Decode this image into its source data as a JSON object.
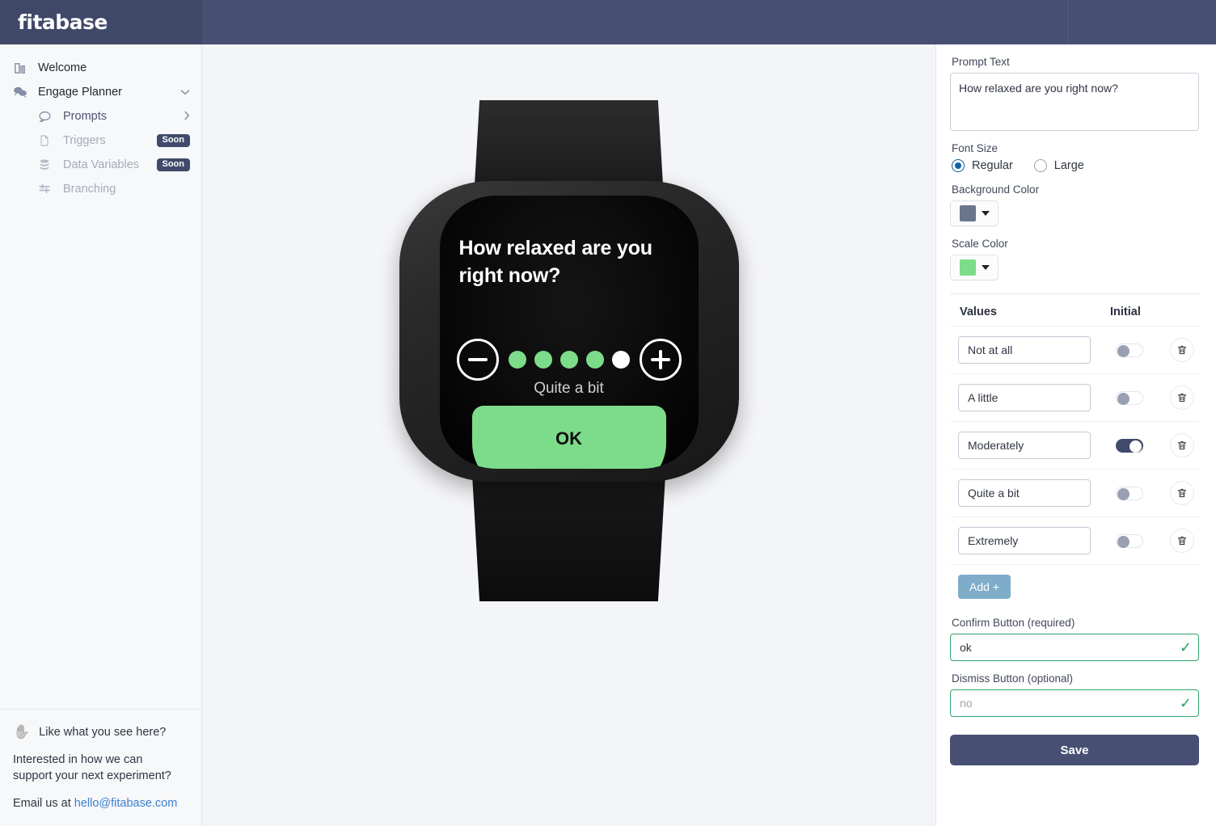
{
  "brand": {
    "name": "fitabase"
  },
  "sidebar": {
    "items": [
      {
        "label": "Welcome",
        "icon": "door-icon",
        "state": "root",
        "badge": null,
        "chevron": null
      },
      {
        "label": "Engage Planner",
        "icon": "comments-icon",
        "state": "root",
        "badge": null,
        "chevron": "chevron-down-icon"
      },
      {
        "label": "Prompts",
        "icon": "chat-bubble-icon",
        "state": "active",
        "badge": null,
        "chevron": "chevron-right-icon"
      },
      {
        "label": "Triggers",
        "icon": "file-icon",
        "state": "disabled",
        "badge": "Soon",
        "chevron": null
      },
      {
        "label": "Data Variables",
        "icon": "database-icon",
        "state": "disabled",
        "badge": "Soon",
        "chevron": null
      },
      {
        "label": "Branching",
        "icon": "branching-icon",
        "state": "disabled",
        "badge": null,
        "chevron": null
      }
    ],
    "footer": {
      "hand_icon": "hand-icon",
      "heading": "Like what you see here?",
      "body": "Interested in how we can support your next experiment?",
      "email_prefix": "Email us at ",
      "email": "hello@fitabase.com"
    }
  },
  "preview": {
    "question": "How relaxed are you right now?",
    "minus_icon": "minus-circle-icon",
    "plus_icon": "plus-circle-icon",
    "dots_total": 5,
    "dots_filled": 4,
    "selected_label": "Quite a bit",
    "confirm_label": "OK",
    "screen_bg": "#000000",
    "scale_color": "#7ddc8a",
    "dot_inactive_color": "#ffffff"
  },
  "panel": {
    "prompt_text_label": "Prompt Text",
    "prompt_text_value": "How relaxed are you right now?",
    "font_size_label": "Font Size",
    "font_size_options": [
      {
        "label": "Regular",
        "selected": true
      },
      {
        "label": "Large",
        "selected": false
      }
    ],
    "background_color_label": "Background Color",
    "background_color_value": "#6a748a",
    "scale_color_label": "Scale Color",
    "scale_color_value": "#7ddc8a",
    "table": {
      "col_values": "Values",
      "col_initial": "Initial",
      "rows": [
        {
          "value": "Not at all",
          "initial": false,
          "delete_icon": "trash-icon"
        },
        {
          "value": "A little",
          "initial": false,
          "delete_icon": "trash-icon"
        },
        {
          "value": "Moderately",
          "initial": true,
          "delete_icon": "trash-icon"
        },
        {
          "value": "Quite a bit",
          "initial": false,
          "delete_icon": "trash-icon"
        },
        {
          "value": "Extremely",
          "initial": false,
          "delete_icon": "trash-icon"
        }
      ],
      "add_label": "Add +"
    },
    "confirm_label": "Confirm Button (required)",
    "confirm_value": "ok",
    "confirm_valid_icon": "check-icon",
    "dismiss_label": "Dismiss Button (optional)",
    "dismiss_value": "",
    "dismiss_placeholder": "no",
    "dismiss_valid_icon": "check-icon",
    "save_label": "Save"
  },
  "colors": {
    "header_navy": "#474f73",
    "accent_green": "#7ddc8a",
    "add_blue": "#7fadc9",
    "valid_green": "#2fa36b"
  }
}
